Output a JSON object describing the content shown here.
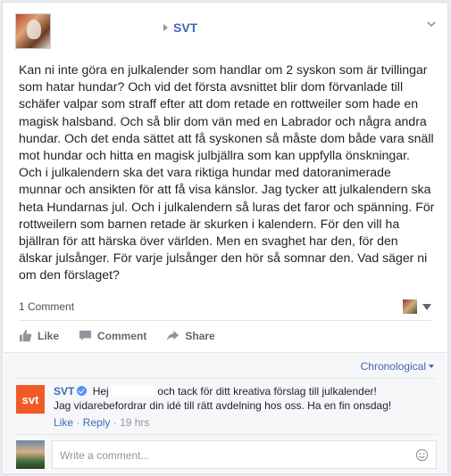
{
  "post": {
    "page_name": "SVT",
    "text": "Kan ni inte göra en julkalender som handlar om 2 syskon som är tvillingar som hatar hundar? Och vid det första avsnittet blir dom förvanlade till schäfer valpar som straff efter att dom retade en rottweiler som hade en magisk halsband. Och så blir dom vän med en Labrador och några andra hundar. Och det enda sättet att få syskonen så måste dom både vara snäll mot hundar och hitta en magisk julbjällra som kan uppfylla önskningar. Och i julkalendern ska det vara riktiga hundar med datoranimerade munnar och ansikten för att få visa känslor. Jag tycker att julkalendern ska heta Hundarnas jul. Och i julkalendern så luras det faror och spänning. För rottweilern som barnen retade är skurken i kalendern. För den vill ha bjällran för att härska över världen. Men en svaghet har den, för den älskar julsånger. För varje julsånger den hör så somnar den. Vad säger ni om den förslaget?",
    "comments_count": "1 Comment"
  },
  "actions": {
    "like": "Like",
    "comment": "Comment",
    "share": "Share"
  },
  "comments": {
    "sort_label": "Chronological",
    "items": [
      {
        "author": "SVT",
        "logo_text": "svt",
        "text_before": "Hej",
        "text_after": "och tack för ditt kreativa förslag till julkalender! Jag vidarebefordrar din idé till rätt avdelning hos oss. Ha en fin onsdag!",
        "like_label": "Like",
        "reply_label": "Reply",
        "time": "19 hrs"
      }
    ],
    "input_placeholder": "Write a comment..."
  },
  "colors": {
    "link": "#4267b2",
    "svt_orange": "#f05a28",
    "verified": "#5890ff"
  },
  "icons": [
    "chevron-down-icon",
    "like-icon",
    "comment-icon",
    "share-icon",
    "verified-badge-icon",
    "smiley-icon",
    "triangle-right-icon"
  ]
}
